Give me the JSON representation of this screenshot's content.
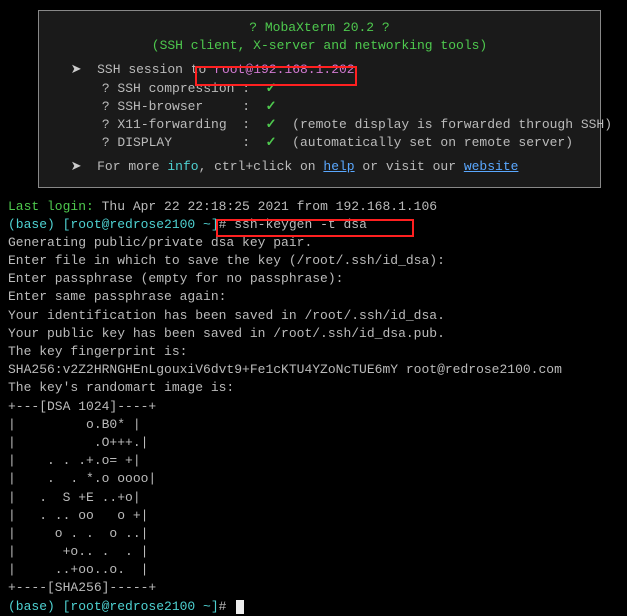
{
  "banner": {
    "title_line1": "? MobaXterm 20.2 ?",
    "title_line2": "(SSH client, X-server and networking tools)",
    "session_prefix": "SSH session to ",
    "session_user": "root",
    "session_at": "@",
    "session_host": "192.168.1.202",
    "items": [
      {
        "label": "? SSH compression :",
        "mark": "✓",
        "note": ""
      },
      {
        "label": "? SSH-browser     :",
        "mark": "✓",
        "note": ""
      },
      {
        "label": "? X11-forwarding  :",
        "mark": "✓",
        "note": "(remote display is forwarded through SSH)"
      },
      {
        "label": "? DISPLAY         :",
        "mark": "✓",
        "note": "(automatically set on remote server)"
      }
    ],
    "help_prefix": "For more ",
    "help_info_word": "info",
    "help_mid": ", ctrl+click on ",
    "help_link1": "help",
    "help_or": " or visit our ",
    "help_link2": "website"
  },
  "term": {
    "last_login_label": "Last login:",
    "last_login_value": " Thu Apr 22 22:18:25 2021 from 192.168.1.106",
    "prompt1_env": "(base)",
    "prompt1_userhost": " [root@redrose2100 ~]",
    "prompt1_hash": "# ",
    "cmd1": "ssh-keygen -t dsa",
    "out": [
      "Generating public/private dsa key pair.",
      "Enter file in which to save the key (/root/.ssh/id_dsa):",
      "Enter passphrase (empty for no passphrase):",
      "Enter same passphrase again:",
      "Your identification has been saved in /root/.ssh/id_dsa.",
      "Your public key has been saved in /root/.ssh/id_dsa.pub.",
      "The key fingerprint is:",
      "SHA256:v2Z2HRNGHEnLgouxiV6dvt9+Fe1cKTU4YZoNcTUE6mY root@redrose2100.com",
      "The key's randomart image is:",
      "+---[DSA 1024]----+",
      "|         o.B0* |",
      "|          .O+++.|",
      "|    . . .+.o= +|",
      "|    .  . *.o oooo|",
      "|   .  S +E ..+o|",
      "|   . .. oo   o +|",
      "|     o . .  o ..|",
      "|      +o.. .  . |",
      "|     ..+oo..o.  |",
      "+----[SHA256]-----+"
    ],
    "prompt2_env": "(base)",
    "prompt2_userhost": " [root@redrose2100 ~]",
    "prompt2_hash": "# "
  }
}
